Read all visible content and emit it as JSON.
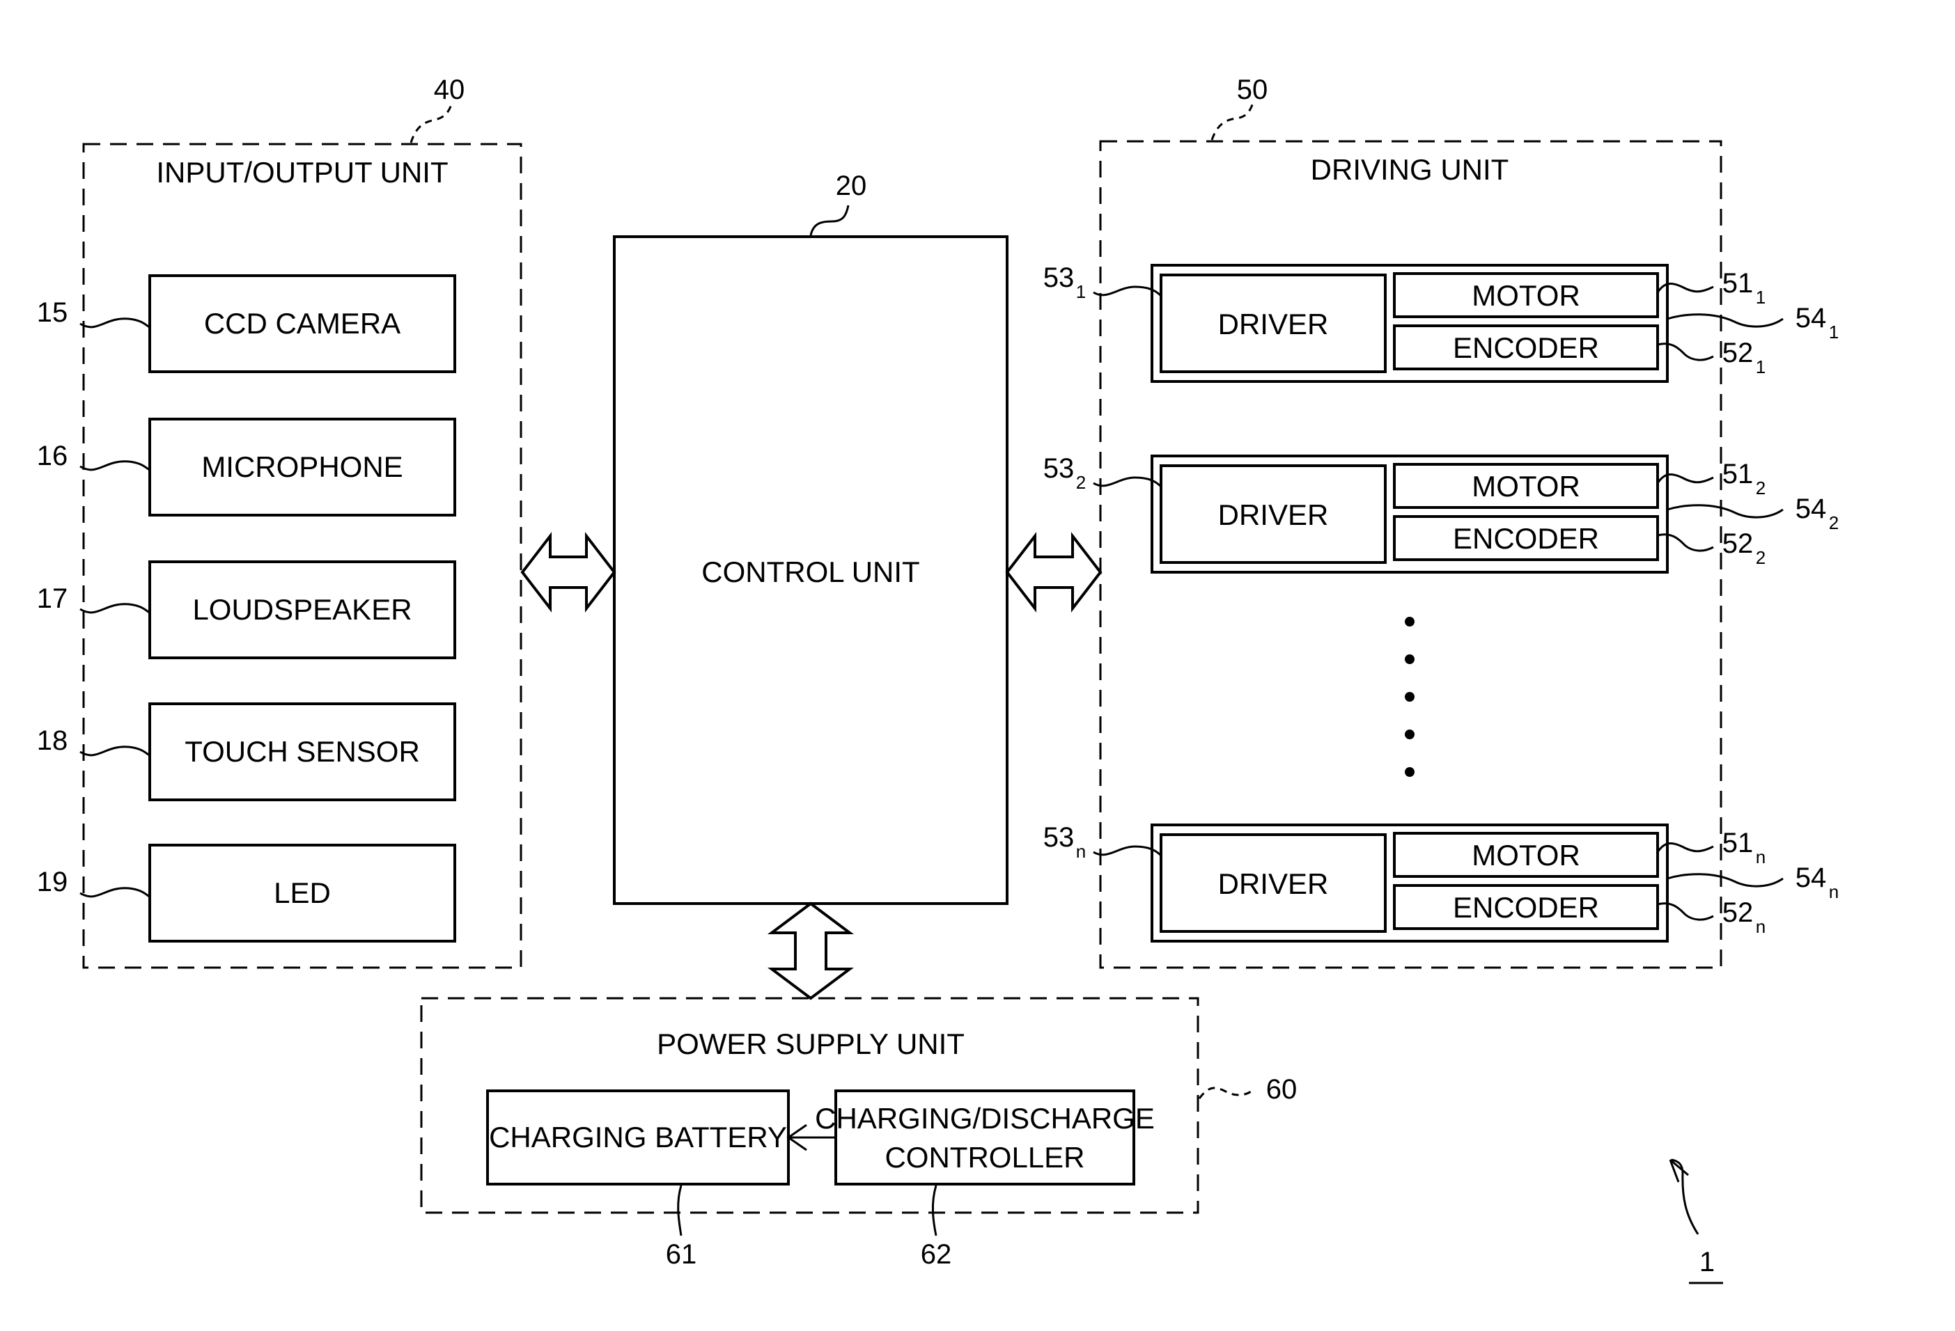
{
  "diagram": {
    "system_ref": "1",
    "io_unit": {
      "ref": "40",
      "title": "INPUT/OUTPUT UNIT",
      "items": [
        {
          "ref": "15",
          "label": "CCD CAMERA"
        },
        {
          "ref": "16",
          "label": "MICROPHONE"
        },
        {
          "ref": "17",
          "label": "LOUDSPEAKER"
        },
        {
          "ref": "18",
          "label": "TOUCH SENSOR"
        },
        {
          "ref": "19",
          "label": "LED"
        }
      ]
    },
    "control_unit": {
      "ref": "20",
      "label": "CONTROL UNIT"
    },
    "driving_unit": {
      "ref": "50",
      "title": "DRIVING UNIT",
      "modules": [
        {
          "driver_ref": "53",
          "motor_ref": "51",
          "encoder_ref": "52",
          "module_ref": "54",
          "sub": "1",
          "driver_label": "DRIVER",
          "motor_label": "MOTOR",
          "encoder_label": "ENCODER"
        },
        {
          "driver_ref": "53",
          "motor_ref": "51",
          "encoder_ref": "52",
          "module_ref": "54",
          "sub": "2",
          "driver_label": "DRIVER",
          "motor_label": "MOTOR",
          "encoder_label": "ENCODER"
        },
        {
          "driver_ref": "53",
          "motor_ref": "51",
          "encoder_ref": "52",
          "module_ref": "54",
          "sub": "n",
          "driver_label": "DRIVER",
          "motor_label": "MOTOR",
          "encoder_label": "ENCODER"
        }
      ],
      "ellipsis_dots": 5
    },
    "power_supply_unit": {
      "ref": "60",
      "title": "POWER SUPPLY UNIT",
      "battery": {
        "ref": "61",
        "label": "CHARGING BATTERY"
      },
      "controller": {
        "ref": "62",
        "label_line1": "CHARGING/DISCHARGE",
        "label_line2": "CONTROLLER"
      }
    }
  }
}
